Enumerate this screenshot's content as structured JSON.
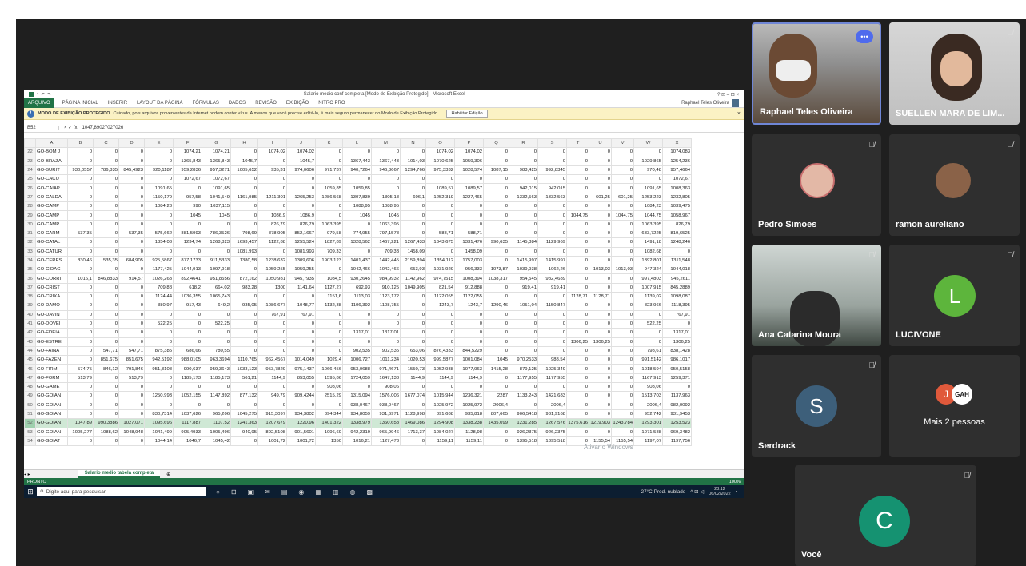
{
  "excel": {
    "title": "Salario medio conf completa [Modo de Exibição Protegido] - Microsoft Excel",
    "window_controls": "?  ⊡  –  ⊡  ×",
    "tabs": [
      "ARQUIVO",
      "PÁGINA INICIAL",
      "INSERIR",
      "LAYOUT DA PÁGINA",
      "FÓRMULAS",
      "DADOS",
      "REVISÃO",
      "EXIBIÇÃO",
      "NITRO PRO"
    ],
    "user": "Raphael Teles Oliveira",
    "protected_label": "MODO DE EXIBIÇÃO PROTEGIDO",
    "protected_message": "Cuidado, pois arquivos provenientes da Internet podem conter vírus. A menos que você precise editá-lo, é mais seguro permanecer no Modo de Exibição Protegido.",
    "enable_button": "Habilitar Edição",
    "name_box": "B52",
    "formula_value": "1047,89027027026",
    "columns": [
      "",
      "A",
      "B",
      "C",
      "D",
      "E",
      "F",
      "G",
      "H",
      "I",
      "J",
      "K",
      "L",
      "M",
      "N",
      "O",
      "P",
      "Q",
      "R",
      "S",
      "T",
      "U",
      "V",
      "W",
      "X"
    ],
    "rows": [
      [
        "22",
        "GO-BOM J",
        "0",
        "0",
        "0",
        "0",
        "1074,21",
        "1074,21",
        "0",
        "1074,02",
        "1074,02",
        "0",
        "0",
        "0",
        "0",
        "1074,02",
        "1074,02",
        "0",
        "0",
        "0",
        "0",
        "0",
        "0",
        "0",
        "1074,083"
      ],
      [
        "23",
        "GO-BRAZA",
        "0",
        "0",
        "0",
        "0",
        "1365,843",
        "1365,843",
        "1045,7",
        "0",
        "1045,7",
        "0",
        "1367,443",
        "1367,443",
        "1014,03",
        "1070,625",
        "1059,306",
        "0",
        "0",
        "0",
        "0",
        "0",
        "0",
        "1029,865",
        "1254,236"
      ],
      [
        "24",
        "GO-BURIT",
        "930,0557",
        "786,835",
        "845,4923",
        "920,1187",
        "959,2836",
        "957,3271",
        "1005,652",
        "935,31",
        "974,0606",
        "971,737",
        "940,7264",
        "946,3667",
        "1294,766",
        "975,3332",
        "1028,574",
        "1087,15",
        "983,425",
        "992,8345",
        "0",
        "0",
        "0",
        "970,48",
        "957,4664"
      ],
      [
        "25",
        "GO-CACU",
        "0",
        "0",
        "0",
        "0",
        "1072,67",
        "1072,67",
        "0",
        "0",
        "0",
        "0",
        "0",
        "0",
        "0",
        "0",
        "0",
        "0",
        "0",
        "0",
        "0",
        "0",
        "0",
        "0",
        "1072,67"
      ],
      [
        "26",
        "GO-CAIAP",
        "0",
        "0",
        "0",
        "1091,65",
        "0",
        "1091,65",
        "0",
        "0",
        "0",
        "1059,85",
        "1059,85",
        "0",
        "0",
        "1089,57",
        "1089,57",
        "0",
        "942,015",
        "942,015",
        "0",
        "0",
        "0",
        "1091,65",
        "1008,363"
      ],
      [
        "27",
        "GO-CALDA",
        "0",
        "0",
        "0",
        "1150,179",
        "957,58",
        "1041,549",
        "1161,985",
        "1211,301",
        "1265,253",
        "1286,568",
        "1307,839",
        "1305,18",
        "606,1",
        "1252,319",
        "1227,465",
        "0",
        "1332,563",
        "1332,563",
        "0",
        "601,25",
        "601,25",
        "1253,223",
        "1232,805"
      ],
      [
        "28",
        "GO-CAMP",
        "0",
        "0",
        "0",
        "1084,23",
        "990",
        "1037,115",
        "0",
        "0",
        "0",
        "0",
        "1088,95",
        "1088,95",
        "0",
        "0",
        "0",
        "0",
        "0",
        "0",
        "0",
        "0",
        "0",
        "1084,23",
        "1039,475"
      ],
      [
        "29",
        "GO-CAMP",
        "0",
        "0",
        "0",
        "0",
        "1045",
        "1045",
        "0",
        "1086,9",
        "1086,9",
        "0",
        "1045",
        "1045",
        "0",
        "0",
        "0",
        "0",
        "0",
        "0",
        "1044,75",
        "0",
        "1044,75",
        "1044,75",
        "1058,967"
      ],
      [
        "30",
        "GO-CAMP",
        "0",
        "0",
        "0",
        "0",
        "0",
        "0",
        "0",
        "826,79",
        "826,79",
        "1063,395",
        "0",
        "1063,395",
        "0",
        "0",
        "0",
        "0",
        "0",
        "0",
        "0",
        "0",
        "0",
        "1063,395",
        "826,79"
      ],
      [
        "31",
        "GO-CARM",
        "537,35",
        "0",
        "537,35",
        "575,662",
        "881,5993",
        "786,3526",
        "798,69",
        "878,905",
        "852,1667",
        "979,58",
        "774,955",
        "797,1578",
        "0",
        "588,71",
        "588,71",
        "0",
        "0",
        "0",
        "0",
        "0",
        "0",
        "633,7225",
        "819,6525"
      ],
      [
        "32",
        "GO-CATAL",
        "0",
        "0",
        "0",
        "1354,03",
        "1234,74",
        "1268,823",
        "1693,457",
        "1122,88",
        "1255,524",
        "1827,89",
        "1328,562",
        "1467,221",
        "1267,433",
        "1343,675",
        "1331,476",
        "990,635",
        "1145,384",
        "1129,969",
        "0",
        "0",
        "0",
        "1491,18",
        "1248,246"
      ],
      [
        "33",
        "GO-CATUR",
        "0",
        "0",
        "0",
        "0",
        "0",
        "0",
        "1081,993",
        "0",
        "1081,993",
        "709,33",
        "0",
        "709,33",
        "1458,09",
        "0",
        "1458,09",
        "0",
        "0",
        "0",
        "0",
        "0",
        "0",
        "1082,68",
        "0"
      ],
      [
        "34",
        "GO-CERES",
        "830,46",
        "535,35",
        "684,905",
        "925,5867",
        "877,1733",
        "911,5333",
        "1380,58",
        "1238,632",
        "1309,606",
        "1903,123",
        "1401,437",
        "1442,445",
        "2159,894",
        "1354,112",
        "1757,003",
        "0",
        "1415,997",
        "1415,997",
        "0",
        "0",
        "0",
        "1392,801",
        "1311,548"
      ],
      [
        "35",
        "GO-CIDAC",
        "0",
        "0",
        "0",
        "1177,425",
        "1044,913",
        "1097,918",
        "0",
        "1059,255",
        "1059,255",
        "0",
        "1042,466",
        "1042,466",
        "653,93",
        "1031,929",
        "956,333",
        "1073,87",
        "1039,938",
        "1062,26",
        "0",
        "1013,03",
        "1013,03",
        "947,324",
        "1044,018"
      ],
      [
        "36",
        "GO-CORRI",
        "1016,1",
        "846,8833",
        "914,57",
        "1026,263",
        "892,4641",
        "951,8556",
        "872,162",
        "1050,981",
        "945,7935",
        "1084,5",
        "930,2645",
        "984,9932",
        "1142,962",
        "974,7515",
        "1008,394",
        "1038,317",
        "954,545",
        "982,4689",
        "0",
        "0",
        "0",
        "997,4803",
        "945,2611"
      ],
      [
        "37",
        "GO-CRIST",
        "0",
        "0",
        "0",
        "709,88",
        "618,2",
        "664,02",
        "983,28",
        "1300",
        "1141,64",
        "1127,27",
        "692,93",
        "910,125",
        "1049,905",
        "821,54",
        "912,888",
        "0",
        "919,41",
        "919,41",
        "0",
        "0",
        "0",
        "1007,915",
        "845,2889"
      ],
      [
        "38",
        "GO-CRIXA",
        "0",
        "0",
        "0",
        "1124,44",
        "1036,355",
        "1065,743",
        "0",
        "0",
        "0",
        "1151,6",
        "1113,03",
        "1123,172",
        "0",
        "1122,055",
        "1122,055",
        "0",
        "0",
        "0",
        "1128,71",
        "1128,71",
        "0",
        "1139,02",
        "1098,087"
      ],
      [
        "39",
        "GO-DAMO",
        "0",
        "0",
        "0",
        "380,97",
        "917,43",
        "649,2",
        "935,05",
        "1086,677",
        "1048,77",
        "1132,38",
        "1106,392",
        "1108,755",
        "0",
        "1243,7",
        "1243,7",
        "1290,46",
        "1051,04",
        "1150,847",
        "0",
        "0",
        "0",
        "823,966",
        "1118,395"
      ],
      [
        "40",
        "GO-DAVIN",
        "0",
        "0",
        "0",
        "0",
        "0",
        "0",
        "0",
        "767,91",
        "767,91",
        "0",
        "0",
        "0",
        "0",
        "0",
        "0",
        "0",
        "0",
        "0",
        "0",
        "0",
        "0",
        "0",
        "767,91"
      ],
      [
        "41",
        "GO-DOVEI",
        "0",
        "0",
        "0",
        "522,25",
        "0",
        "522,25",
        "0",
        "0",
        "0",
        "0",
        "0",
        "0",
        "0",
        "0",
        "0",
        "0",
        "0",
        "0",
        "0",
        "0",
        "0",
        "522,25",
        "0"
      ],
      [
        "42",
        "GO-EDEIA",
        "0",
        "0",
        "0",
        "0",
        "0",
        "0",
        "0",
        "0",
        "0",
        "0",
        "1317,01",
        "1317,01",
        "0",
        "0",
        "0",
        "0",
        "0",
        "0",
        "0",
        "0",
        "0",
        "0",
        "1317,01"
      ],
      [
        "43",
        "GO-ESTRE",
        "0",
        "0",
        "0",
        "0",
        "0",
        "0",
        "0",
        "0",
        "0",
        "0",
        "0",
        "0",
        "0",
        "0",
        "0",
        "0",
        "0",
        "0",
        "1306,25",
        "1306,25",
        "0",
        "0",
        "1306,25"
      ],
      [
        "44",
        "GO-FAINA",
        "0",
        "547,71",
        "547,71",
        "875,385",
        "686,66",
        "780,55",
        "0",
        "0",
        "0",
        "0",
        "902,535",
        "902,535",
        "653,06",
        "876,4333",
        "844,5229",
        "0",
        "0",
        "0",
        "0",
        "0",
        "0",
        "798,61",
        "838,1428"
      ],
      [
        "45",
        "GO-FAZEN",
        "0",
        "851,675",
        "851,675",
        "942,5192",
        "988,0105",
        "963,3694",
        "1110,765",
        "962,4567",
        "1014,049",
        "1029,4",
        "1006,727",
        "1011,234",
        "1020,53",
        "999,5877",
        "1001,084",
        "1045",
        "970,2533",
        "988,54",
        "0",
        "0",
        "0",
        "991,5142",
        "986,1017"
      ],
      [
        "46",
        "GO-FIRMI",
        "574,75",
        "846,12",
        "791,846",
        "951,3108",
        "990,637",
        "959,3643",
        "1033,123",
        "953,7829",
        "975,1437",
        "1066,456",
        "953,0688",
        "971,4671",
        "1550,73",
        "1052,938",
        "1077,963",
        "1415,28",
        "879,125",
        "1025,349",
        "0",
        "0",
        "0",
        "1018,594",
        "950,5158"
      ],
      [
        "47",
        "GO-FORM",
        "513,79",
        "0",
        "513,79",
        "0",
        "1185,173",
        "1185,173",
        "561,21",
        "1144,9",
        "853,055",
        "1595,86",
        "1724,059",
        "1647,138",
        "1144,9",
        "1144,9",
        "1144,9",
        "0",
        "1177,955",
        "1177,955",
        "0",
        "0",
        "0",
        "1167,913",
        "1259,371"
      ],
      [
        "48",
        "GO-GAME",
        "0",
        "0",
        "0",
        "0",
        "0",
        "0",
        "0",
        "0",
        "0",
        "908,06",
        "0",
        "908,06",
        "0",
        "0",
        "0",
        "0",
        "0",
        "0",
        "0",
        "0",
        "0",
        "908,06",
        "0"
      ],
      [
        "49",
        "GO-GOIAN",
        "0",
        "0",
        "0",
        "1250,993",
        "1052,155",
        "1147,892",
        "877,132",
        "949,79",
        "909,4244",
        "2515,29",
        "1315,094",
        "1576,006",
        "1677,074",
        "1015,944",
        "1236,321",
        "2287",
        "1133,243",
        "1421,683",
        "0",
        "0",
        "0",
        "1513,703",
        "1137,963"
      ],
      [
        "50",
        "GO-GOIAN",
        "0",
        "0",
        "0",
        "0",
        "0",
        "0",
        "0",
        "0",
        "0",
        "0",
        "938,0467",
        "938,0467",
        "0",
        "1025,972",
        "1025,972",
        "2006,4",
        "0",
        "2006,4",
        "0",
        "0",
        "0",
        "2006,4",
        "982,0092"
      ],
      [
        "51",
        "GO-GOIAN",
        "0",
        "0",
        "0",
        "830,7314",
        "1037,626",
        "965,206",
        "1045,275",
        "915,3097",
        "934,3802",
        "894,344",
        "934,8059",
        "931,6971",
        "1128,998",
        "891,688",
        "935,818",
        "807,665",
        "906,5418",
        "931,9168",
        "0",
        "0",
        "0",
        "952,742",
        "931,9453"
      ],
      [
        "52",
        "GO-GOIAN",
        "1047,89",
        "990,3886",
        "1027,071",
        "1095,696",
        "1117,887",
        "1107,52",
        "1241,363",
        "1207,679",
        "1220,96",
        "1401,322",
        "1338,979",
        "1360,658",
        "1469,086",
        "1294,908",
        "1338,238",
        "1435,099",
        "1231,285",
        "1267,576",
        "1375,616",
        "1219,903",
        "1243,784",
        "1293,301",
        "1253,523"
      ],
      [
        "53",
        "GO-GOIAN",
        "1005,277",
        "1088,62",
        "1048,948",
        "1041,499",
        "905,4933",
        "1005,496",
        "940,95",
        "892,5108",
        "901,5601",
        "1096,69",
        "942,2319",
        "965,9946",
        "1713,37",
        "1084,027",
        "1128,98",
        "0",
        "926,2375",
        "926,2375",
        "0",
        "0",
        "0",
        "1071,588",
        "969,3482"
      ],
      [
        "54",
        "GO-GOIAT",
        "0",
        "0",
        "0",
        "1044,14",
        "1046,7",
        "1045,42",
        "0",
        "1001,72",
        "1001,72",
        "1350",
        "1016,21",
        "1127,473",
        "0",
        "1159,11",
        "1159,11",
        "0",
        "1395,518",
        "1395,518",
        "0",
        "1155,54",
        "1155,54",
        "1197,07",
        "1197,756"
      ]
    ],
    "selected_row": "52",
    "sheet_tab": "Salario medio tabela completa",
    "status": "PRONTO",
    "zoom": "100%",
    "watermark": "Ativar o Windows",
    "taskbar": {
      "search_placeholder": "Digite aqui para pesquisar",
      "weather": "27°C  Pred. nublado",
      "time": "23:12",
      "date": "06/02/2022"
    }
  },
  "participants": [
    {
      "name": "Raphael Teles Oliveira",
      "active": true
    },
    {
      "name": "SUELLEN MARA DE LIM..."
    },
    {
      "name": "Pedro Simoes"
    },
    {
      "name": "ramon aureliano"
    },
    {
      "name": "Ana Catarina Moura"
    },
    {
      "name": "LUCIVONE",
      "initial": "L",
      "color": "#5db53c"
    },
    {
      "name": "Serdrack",
      "initial": "S",
      "color": "#3d5f7a"
    },
    {
      "name": "Mais 2 pessoas",
      "badge_initial": "J",
      "badge_text": "GAH"
    },
    {
      "name": "Você",
      "initial": "C",
      "color": "#159271"
    }
  ],
  "colors": {
    "excel_green": "#217346",
    "teams_bg": "#1f1f1f",
    "tile_bg": "#2f2f2f",
    "active_border": "#6f86d6"
  }
}
